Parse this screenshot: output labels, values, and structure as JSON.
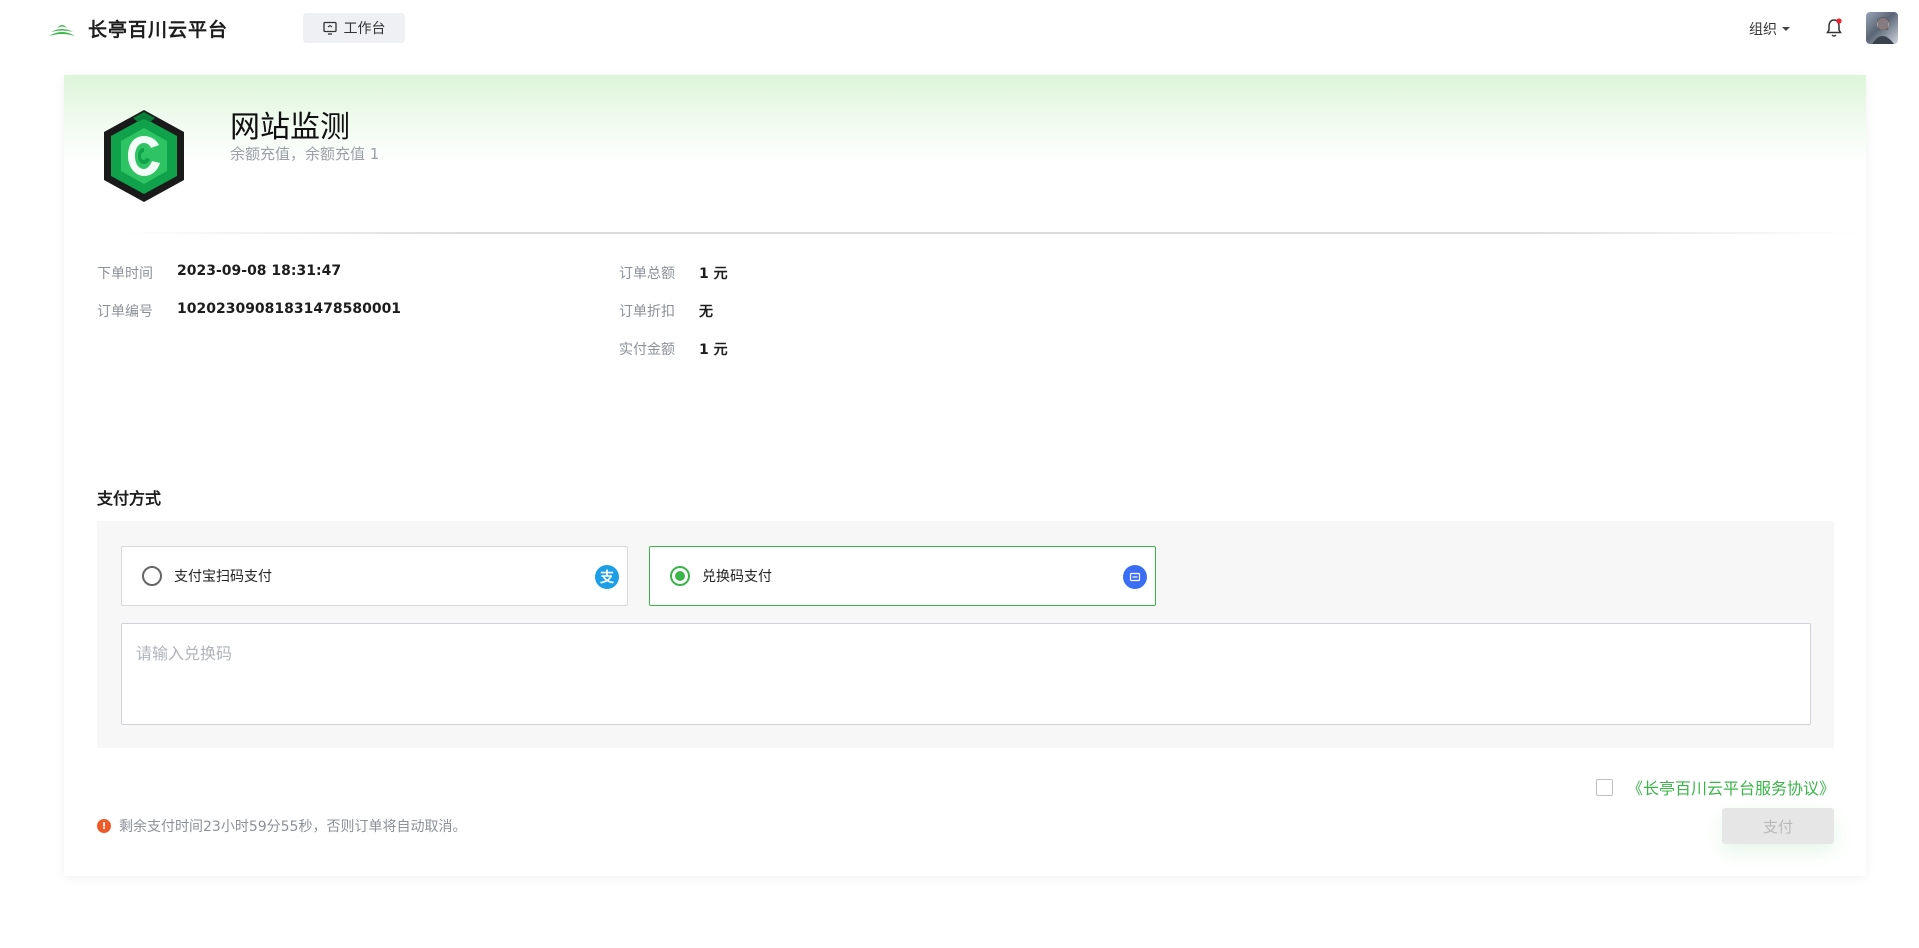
{
  "header": {
    "brand": "长亭百川云平台",
    "workbench_label": "工作台",
    "org_label": "组织",
    "icons": {
      "logo": "changting-logo-icon",
      "workbench": "monitor-icon",
      "bell": "bell-icon",
      "avatar": "user-avatar"
    },
    "accent_color": "#3bb54a"
  },
  "product": {
    "title": "网站监测",
    "subtitle": "余额充值，余额充值 1",
    "icon": "website-monitor-hex-icon"
  },
  "order": {
    "left": [
      {
        "label": "下单时间",
        "value": "2023-09-08 18:31:47"
      },
      {
        "label": "订单编号",
        "value": "10202309081831478580001"
      }
    ],
    "right": [
      {
        "label": "订单总额",
        "value": "1 元"
      },
      {
        "label": "订单折扣",
        "value": "无"
      },
      {
        "label": "实付金额",
        "value": "1 元"
      }
    ]
  },
  "payment": {
    "section_title": "支付方式",
    "options": [
      {
        "label": "支付宝扫码支付",
        "selected": false,
        "icon": "alipay-icon",
        "icon_color": "#1c9fe6"
      },
      {
        "label": "兑换码支付",
        "selected": true,
        "icon": "redeem-code-icon",
        "icon_color": "#3b6ef5"
      }
    ],
    "redeem_placeholder": "请输入兑换码"
  },
  "footer": {
    "agreement_link": "《长亭百川云平台服务协议》",
    "agreement_checked": false,
    "countdown_text": "剩余支付时间23小时59分55秒，否则订单将自动取消。",
    "pay_button": "支付"
  }
}
